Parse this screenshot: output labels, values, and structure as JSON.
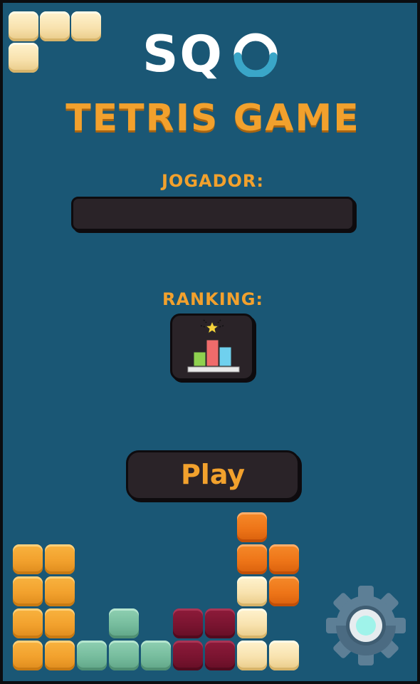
{
  "app": {
    "logo_text": "SQO",
    "logo_main_letters": "SQ"
  },
  "header": {
    "title": "TETRIS GAME"
  },
  "form": {
    "player_label": "JOGADOR:",
    "player_value": "",
    "ranking_label": "RANKING:"
  },
  "actions": {
    "play_label": "Play"
  },
  "icons": {
    "ranking": "podium-star-icon",
    "settings": "gear-icon"
  },
  "colors": {
    "background": "#1a5775",
    "accent": "#f2a12d",
    "button": "#2a2328",
    "logo_ring": "#3aa6c8"
  }
}
